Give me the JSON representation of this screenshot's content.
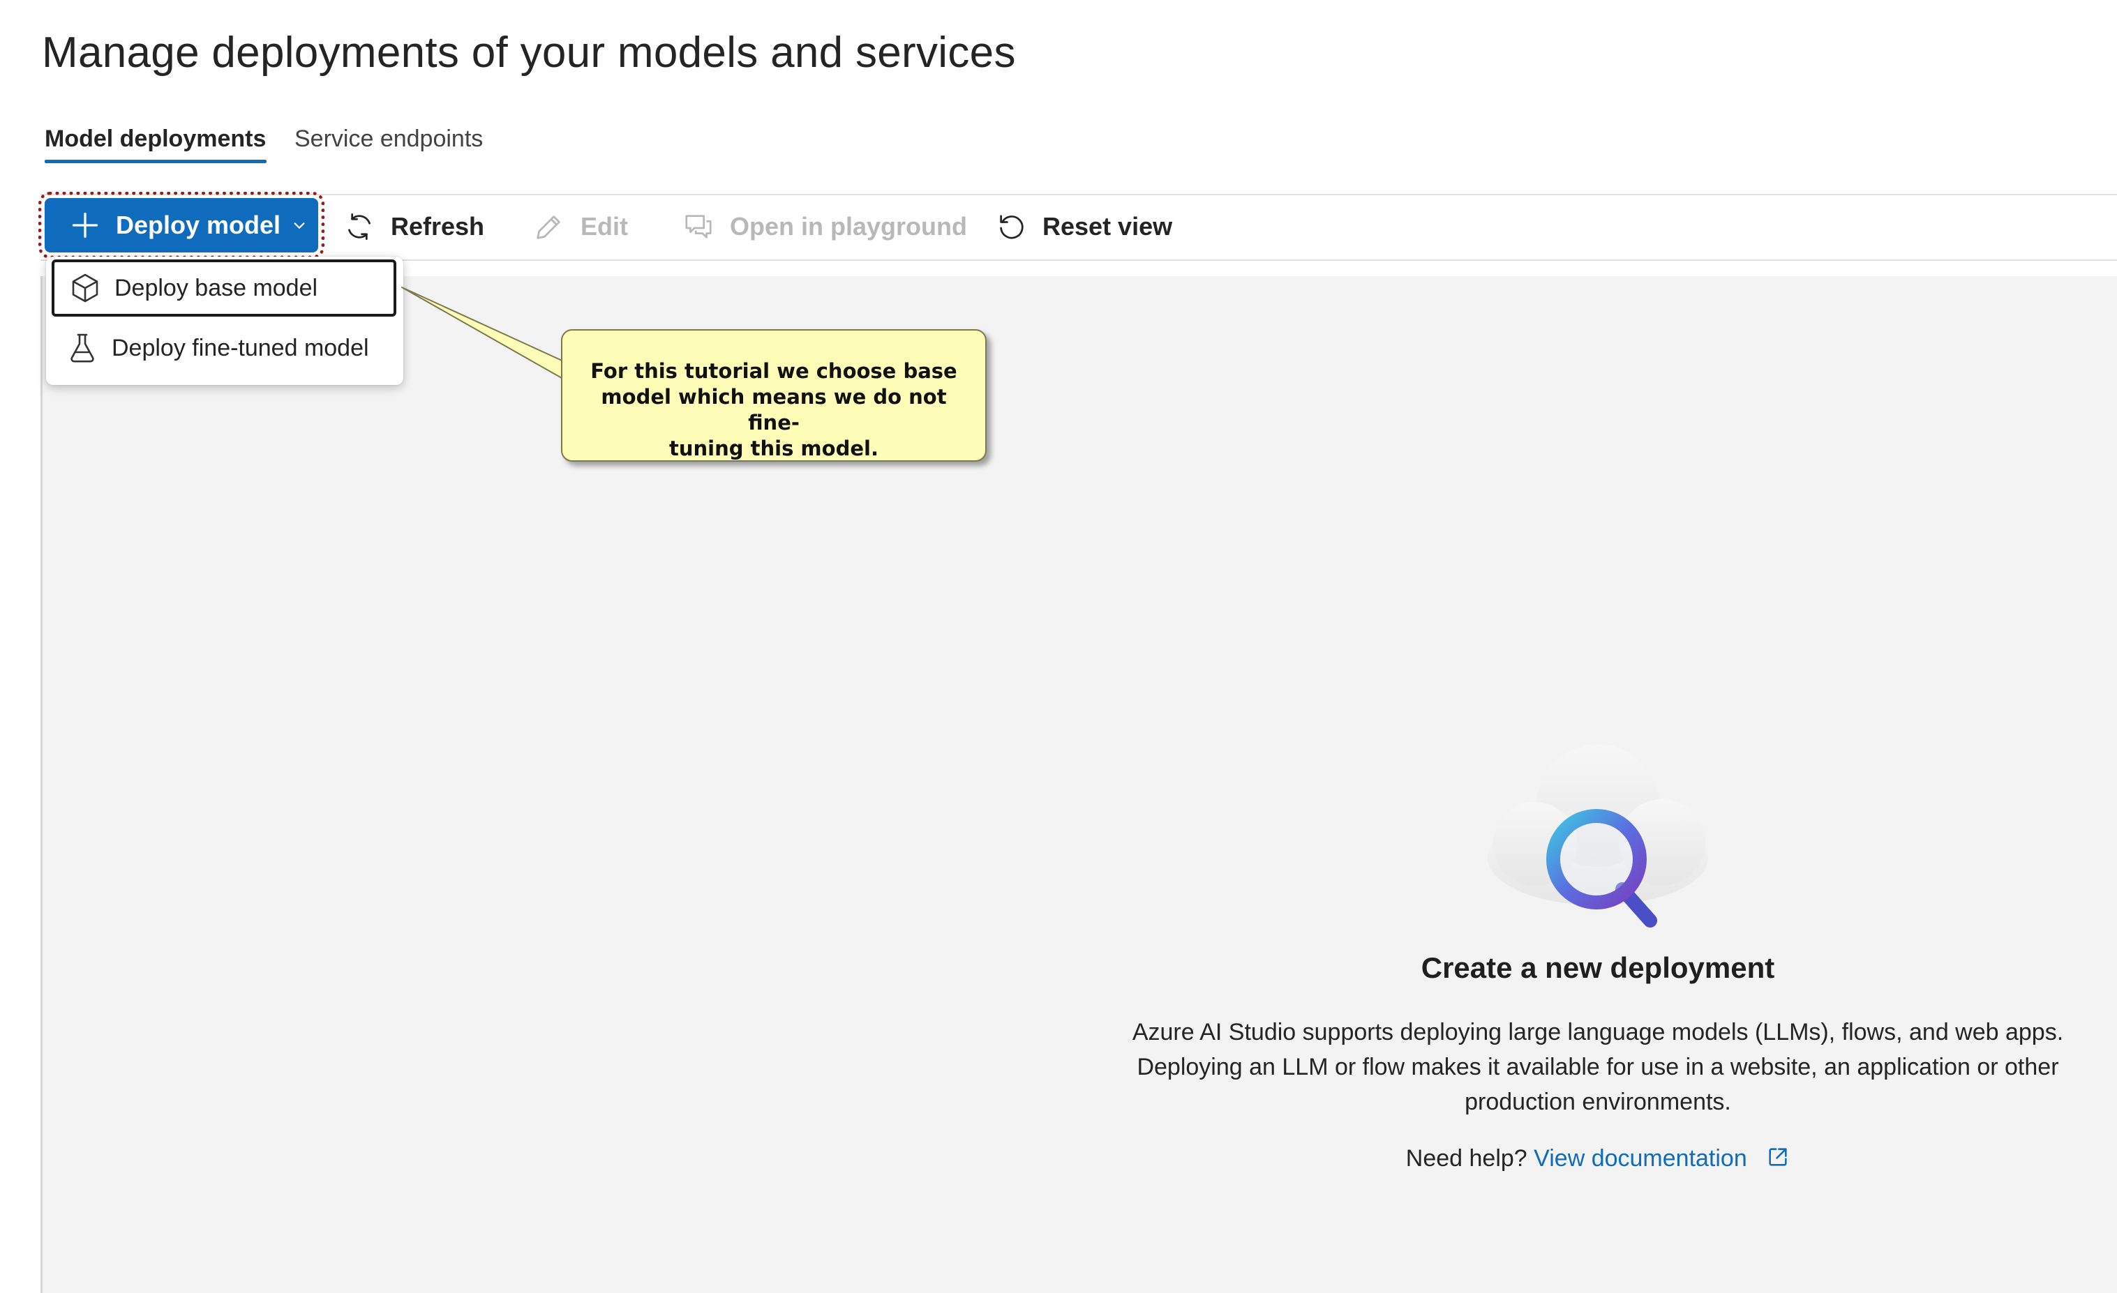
{
  "page": {
    "title": "Manage deployments of your models and services"
  },
  "tabs": [
    {
      "label": "Model deployments",
      "active": true
    },
    {
      "label": "Service endpoints",
      "active": false
    }
  ],
  "toolbar": {
    "deploy_label": "Deploy model",
    "refresh_label": "Refresh",
    "edit_label": "Edit",
    "playground_label": "Open in playground",
    "reset_label": "Reset view"
  },
  "deploy_menu": {
    "items": [
      {
        "label": "Deploy base model",
        "icon": "cube-icon"
      },
      {
        "label": "Deploy fine-tuned model",
        "icon": "flask-icon"
      }
    ]
  },
  "callout": {
    "lines": [
      "For this tutorial we choose base",
      "model which means we do not fine-",
      "tuning this model."
    ]
  },
  "empty_state": {
    "title": "Create a new deployment",
    "description": [
      "Azure AI Studio supports deploying large language models (LLMs), flows, and web apps.",
      "Deploying an LLM or flow makes it available for use in a website, an application or other",
      "production environments."
    ],
    "help_prefix": "Need help?",
    "help_link": "View documentation"
  },
  "colors": {
    "accent": "#0f6cbd",
    "disabled_text": "#b8b8b8",
    "callout_bg": "#fdfdb8",
    "highlight_outline": "#9b1b1b"
  }
}
